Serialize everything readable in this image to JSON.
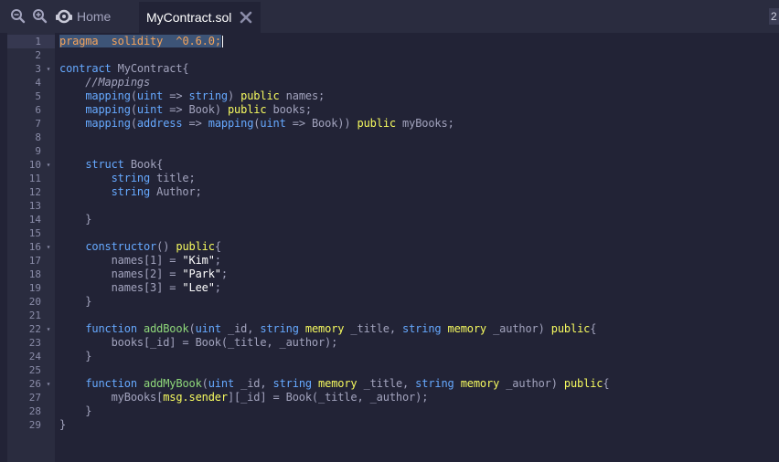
{
  "toolbar": {
    "zoom_out_icon": "zoom-out-icon",
    "zoom_in_icon": "zoom-in-icon"
  },
  "tabs": [
    {
      "label": "Home",
      "icon": "home-icon",
      "active": false
    },
    {
      "label": "MyContract.sol",
      "icon": "close-icon",
      "active": true
    }
  ],
  "right_badge": "2",
  "editor": {
    "lines": [
      {
        "n": "1",
        "fold": false,
        "tokens": [
          [
            "pr",
            "pragma"
          ],
          [
            "",
            "  "
          ],
          [
            "pr",
            "solidity"
          ],
          [
            "",
            "  "
          ],
          [
            "pr",
            "^0.6.0;"
          ]
        ]
      },
      {
        "n": "2",
        "fold": false,
        "tokens": []
      },
      {
        "n": "3",
        "fold": true,
        "tokens": [
          [
            "kw",
            "contract"
          ],
          [
            "",
            " MyContract{"
          ]
        ]
      },
      {
        "n": "4",
        "fold": false,
        "tokens": [
          [
            "cm",
            "    //Mappings"
          ]
        ]
      },
      {
        "n": "5",
        "fold": false,
        "tokens": [
          [
            "",
            "    "
          ],
          [
            "ty",
            "mapping"
          ],
          [
            "",
            "("
          ],
          [
            "ty",
            "uint"
          ],
          [
            "",
            " => "
          ],
          [
            "ty",
            "string"
          ],
          [
            "",
            ") "
          ],
          [
            "mod",
            "public"
          ],
          [
            "",
            " names;"
          ]
        ]
      },
      {
        "n": "6",
        "fold": false,
        "tokens": [
          [
            "",
            "    "
          ],
          [
            "ty",
            "mapping"
          ],
          [
            "",
            "("
          ],
          [
            "ty",
            "uint"
          ],
          [
            "",
            " => Book) "
          ],
          [
            "mod",
            "public"
          ],
          [
            "",
            " books;"
          ]
        ]
      },
      {
        "n": "7",
        "fold": false,
        "tokens": [
          [
            "",
            "    "
          ],
          [
            "ty",
            "mapping"
          ],
          [
            "",
            "("
          ],
          [
            "ty",
            "address"
          ],
          [
            "",
            " => "
          ],
          [
            "ty",
            "mapping"
          ],
          [
            "",
            "("
          ],
          [
            "ty",
            "uint"
          ],
          [
            "",
            " => Book)) "
          ],
          [
            "mod",
            "public"
          ],
          [
            "",
            " myBooks;"
          ]
        ]
      },
      {
        "n": "8",
        "fold": false,
        "tokens": []
      },
      {
        "n": "9",
        "fold": false,
        "tokens": []
      },
      {
        "n": "10",
        "fold": true,
        "tokens": [
          [
            "",
            "    "
          ],
          [
            "kw",
            "struct"
          ],
          [
            "",
            " Book{"
          ]
        ]
      },
      {
        "n": "11",
        "fold": false,
        "tokens": [
          [
            "",
            "        "
          ],
          [
            "ty",
            "string"
          ],
          [
            "",
            " title;"
          ]
        ]
      },
      {
        "n": "12",
        "fold": false,
        "tokens": [
          [
            "",
            "        "
          ],
          [
            "ty",
            "string"
          ],
          [
            "",
            " Author;"
          ]
        ]
      },
      {
        "n": "13",
        "fold": false,
        "tokens": []
      },
      {
        "n": "14",
        "fold": false,
        "tokens": [
          [
            "",
            "    }"
          ]
        ]
      },
      {
        "n": "15",
        "fold": false,
        "tokens": []
      },
      {
        "n": "16",
        "fold": true,
        "tokens": [
          [
            "",
            "    "
          ],
          [
            "kw",
            "constructor"
          ],
          [
            "",
            "() "
          ],
          [
            "mod",
            "public"
          ],
          [
            "",
            "{"
          ]
        ]
      },
      {
        "n": "17",
        "fold": false,
        "tokens": [
          [
            "",
            "        names[1] = "
          ],
          [
            "str",
            "\"Kim\""
          ],
          [
            "",
            ";"
          ]
        ]
      },
      {
        "n": "18",
        "fold": false,
        "tokens": [
          [
            "",
            "        names[2] = "
          ],
          [
            "str",
            "\"Park\""
          ],
          [
            "",
            ";"
          ]
        ]
      },
      {
        "n": "19",
        "fold": false,
        "tokens": [
          [
            "",
            "        names[3] = "
          ],
          [
            "str",
            "\"Lee\""
          ],
          [
            "",
            ";"
          ]
        ]
      },
      {
        "n": "20",
        "fold": false,
        "tokens": [
          [
            "",
            "    }"
          ]
        ]
      },
      {
        "n": "21",
        "fold": false,
        "tokens": []
      },
      {
        "n": "22",
        "fold": true,
        "tokens": [
          [
            "",
            "    "
          ],
          [
            "kw",
            "function"
          ],
          [
            "",
            ""
          ],
          [
            "fn",
            " addBook"
          ],
          [
            "",
            "("
          ],
          [
            "ty",
            "uint"
          ],
          [
            "",
            " _id, "
          ],
          [
            "ty",
            "string"
          ],
          [
            "",
            ""
          ],
          [
            "mod",
            " memory"
          ],
          [
            "",
            " _title, "
          ],
          [
            "ty",
            "string"
          ],
          [
            "",
            ""
          ],
          [
            "mod",
            " memory"
          ],
          [
            "",
            " _author) "
          ],
          [
            "mod",
            "public"
          ],
          [
            "",
            "{"
          ]
        ]
      },
      {
        "n": "23",
        "fold": false,
        "tokens": [
          [
            "",
            "        books[_id] = Book(_title, _author);"
          ]
        ]
      },
      {
        "n": "24",
        "fold": false,
        "tokens": [
          [
            "",
            "    }"
          ]
        ]
      },
      {
        "n": "25",
        "fold": false,
        "tokens": []
      },
      {
        "n": "26",
        "fold": true,
        "tokens": [
          [
            "",
            "    "
          ],
          [
            "kw",
            "function"
          ],
          [
            "",
            ""
          ],
          [
            "fn",
            " addMyBook"
          ],
          [
            "",
            "("
          ],
          [
            "ty",
            "uint"
          ],
          [
            "",
            " _id, "
          ],
          [
            "ty",
            "string"
          ],
          [
            "",
            ""
          ],
          [
            "mod",
            " memory"
          ],
          [
            "",
            " _title, "
          ],
          [
            "ty",
            "string"
          ],
          [
            "",
            ""
          ],
          [
            "mod",
            " memory"
          ],
          [
            "",
            " _author) "
          ],
          [
            "mod",
            "public"
          ],
          [
            "",
            "{"
          ]
        ]
      },
      {
        "n": "27",
        "fold": false,
        "tokens": [
          [
            "",
            "        myBooks["
          ],
          [
            "mod",
            "msg.sender"
          ],
          [
            "",
            "][_id] = Book(_title, _author);"
          ]
        ]
      },
      {
        "n": "28",
        "fold": false,
        "tokens": [
          [
            "",
            "    }"
          ]
        ]
      },
      {
        "n": "29",
        "fold": false,
        "tokens": [
          [
            "",
            "}"
          ]
        ]
      }
    ]
  }
}
